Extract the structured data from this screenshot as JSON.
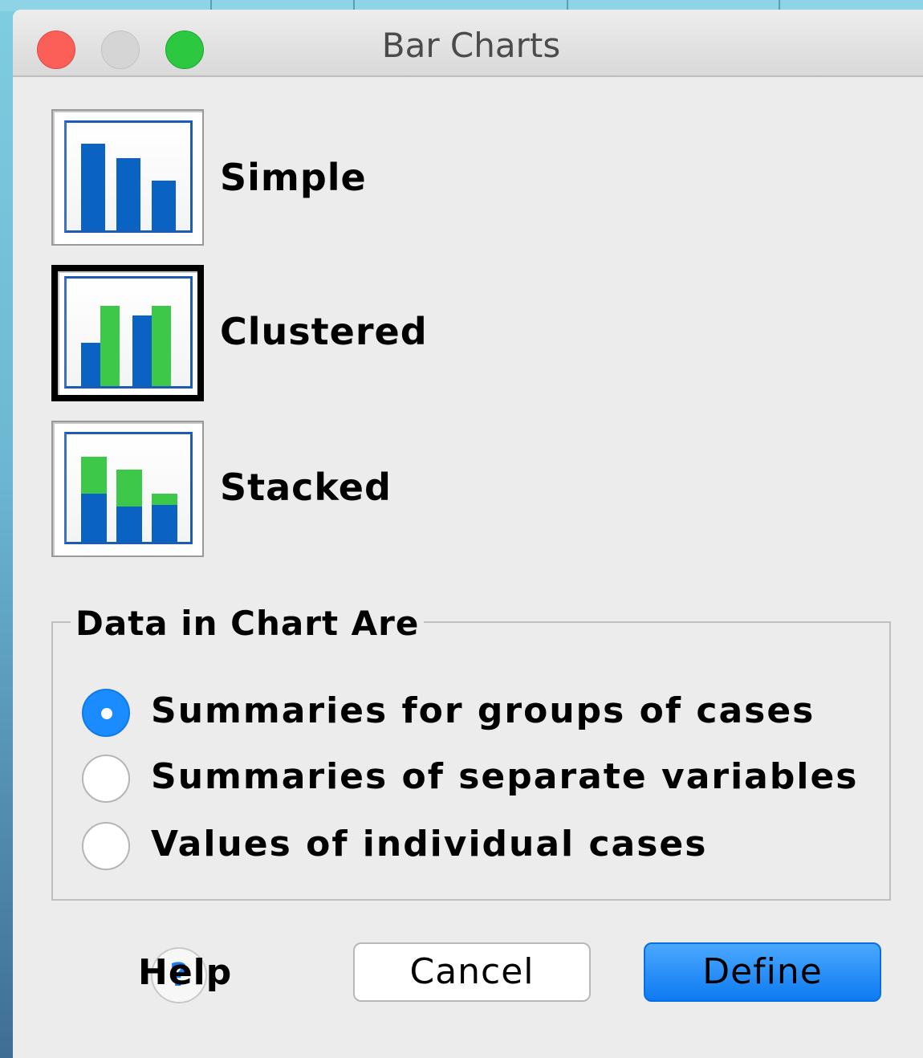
{
  "window": {
    "title": "Bar Charts"
  },
  "chart_types": [
    {
      "label": "Simple",
      "selected": false
    },
    {
      "label": "Clustered",
      "selected": true
    },
    {
      "label": "Stacked",
      "selected": false
    }
  ],
  "data_group": {
    "title": "Data in Chart Are",
    "options": [
      {
        "label": "Summaries for groups of cases",
        "checked": true
      },
      {
        "label": "Summaries of separate variables",
        "checked": false
      },
      {
        "label": "Values of individual cases",
        "checked": false
      }
    ]
  },
  "buttons": {
    "help": "Help",
    "help_icon_glyph": "?",
    "cancel": "Cancel",
    "define": "Define"
  },
  "colors": {
    "accent": "#1a8cff",
    "bar_blue": "#0a62c2",
    "bar_green": "#3ec84a",
    "close": "#fc5f57",
    "zoom": "#2bc840"
  }
}
